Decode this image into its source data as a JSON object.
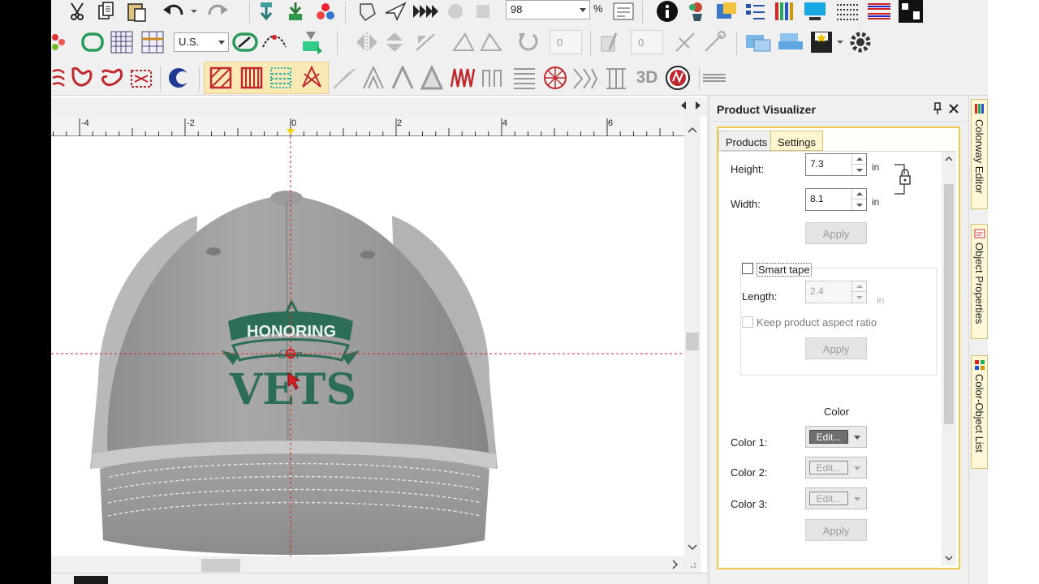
{
  "toolbar": {
    "zoom_value": "98",
    "zoom_unit": "%",
    "region_value": "U.S.",
    "counter_a": "0",
    "counter_b": "0",
    "label_3d": "3D"
  },
  "canvas": {
    "ruler_labels": [
      "-4",
      "-2",
      "0",
      "2",
      "4",
      "6"
    ],
    "design_text_top": "HONORING",
    "design_text_script": "Our",
    "design_text_bottom": "VETS"
  },
  "panel": {
    "title": "Product Visualizer",
    "tabs": [
      {
        "label": "Products",
        "active": false
      },
      {
        "label": "Settings",
        "active": true
      }
    ],
    "height_label": "Height:",
    "height_value": "7.3",
    "width_label": "Width:",
    "width_value": "8.1",
    "unit": "in",
    "apply_label": "Apply",
    "smart_label": "Smart tape",
    "length_label": "Length:",
    "length_value": "2.4",
    "keep_ratio_label": "Keep product aspect ratio",
    "color_heading": "Color",
    "colors": [
      {
        "label": "Color 1:",
        "button": "Edit..."
      },
      {
        "label": "Color 2:",
        "button": "Edit..."
      },
      {
        "label": "Color 3:",
        "button": "Edit..."
      }
    ]
  },
  "dock_tabs": [
    "Colorway Editor",
    "Object Properties",
    "Color-Object List"
  ],
  "colors": {
    "accent_border": "#f0c84b",
    "embroidery_green": "#2c6e55",
    "guide_red": "#d42020"
  }
}
